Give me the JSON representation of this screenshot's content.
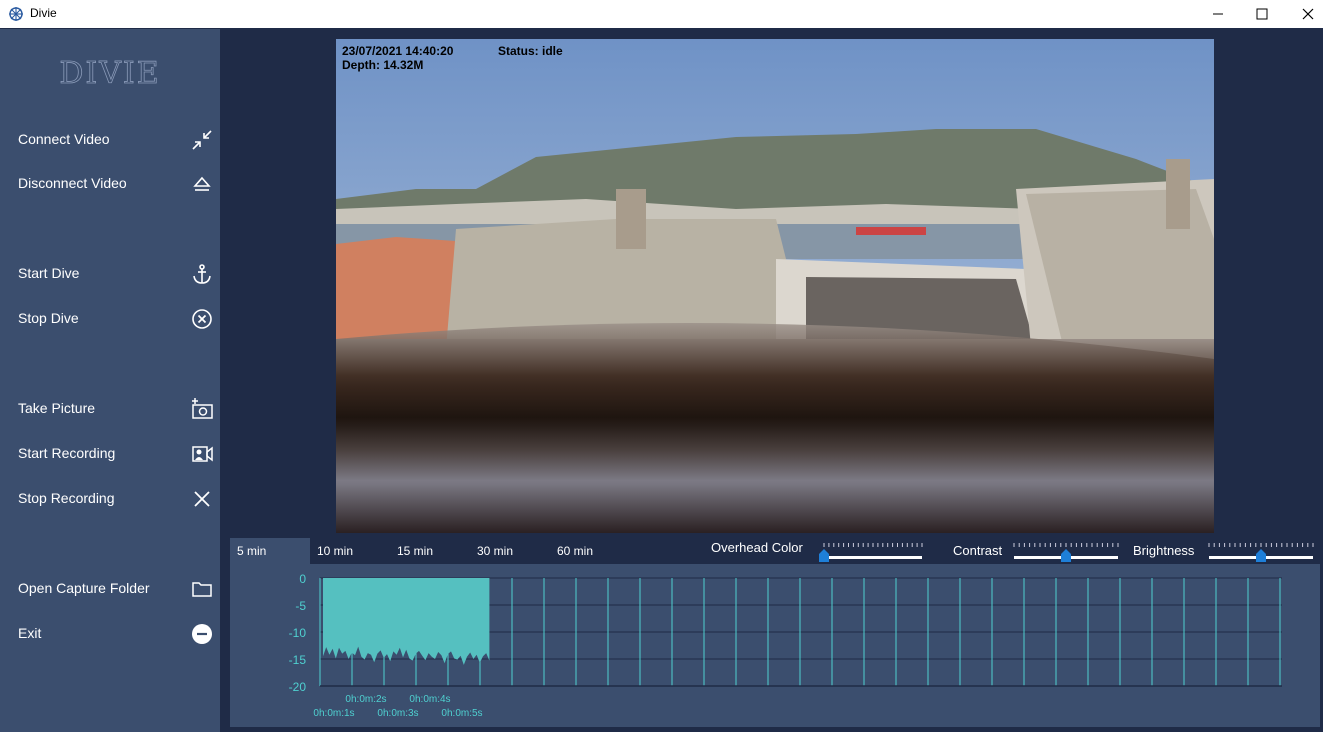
{
  "window": {
    "title": "Divie"
  },
  "logo_text": "DIVIE",
  "sidebar": {
    "items": [
      {
        "label": "Connect Video",
        "icon": "collapse-arrows-icon"
      },
      {
        "label": "Disconnect Video",
        "icon": "eject-icon"
      },
      {
        "label": "Start Dive",
        "icon": "anchor-icon"
      },
      {
        "label": "Stop Dive",
        "icon": "circle-x-icon"
      },
      {
        "label": "Take Picture",
        "icon": "add-camera-icon"
      },
      {
        "label": "Start Recording",
        "icon": "video-camera-icon"
      },
      {
        "label": "Stop Recording",
        "icon": "close-icon"
      },
      {
        "label": "Open Capture Folder",
        "icon": "folder-icon"
      },
      {
        "label": "Exit",
        "icon": "minus-circle-icon"
      }
    ]
  },
  "video": {
    "timestamp": "23/07/2021 14:40:20",
    "status": "Status: idle",
    "depth": "Depth: 14.32M"
  },
  "tabs": [
    {
      "label": "5 min",
      "active": true
    },
    {
      "label": "10 min",
      "active": false
    },
    {
      "label": "15 min",
      "active": false
    },
    {
      "label": "30 min",
      "active": false
    },
    {
      "label": "60 min",
      "active": false
    }
  ],
  "controls": {
    "overhead_color": {
      "label": "Overhead Color",
      "value": 0.0
    },
    "contrast": {
      "label": "Contrast",
      "value": 0.5
    },
    "brightness": {
      "label": "Brightness",
      "value": 0.5
    }
  },
  "colors": {
    "sidebar": "#3b4e6e",
    "background": "#1f2b47",
    "depth_fill": "#55c0c0",
    "axis_text": "#4fd0d0"
  },
  "chart_data": {
    "type": "area",
    "ylim": [
      -20,
      0
    ],
    "y_ticks": [
      "0",
      "-5",
      "-10",
      "-15",
      "-20"
    ],
    "x_tick_labels": [
      "0h:0m:1s",
      "0h:0m:2s",
      "0h:0m:3s",
      "0h:0m:4s",
      "0h:0m:5s"
    ],
    "series": [
      {
        "x": [
          0,
          0.1,
          0.2,
          0.3,
          0.4,
          0.5,
          0.6,
          0.7,
          0.8,
          0.9,
          1.0,
          1.1,
          1.2,
          1.3,
          1.4,
          1.5,
          1.6,
          1.7,
          1.8,
          1.9,
          2.0,
          2.1,
          2.2,
          2.3,
          2.4,
          2.5,
          2.6,
          2.7,
          2.8,
          2.9,
          3.0,
          3.1,
          3.2,
          3.3,
          3.4,
          3.5,
          3.6,
          3.7,
          3.8,
          3.9,
          4.0,
          4.1,
          4.2,
          4.3,
          4.4,
          4.5,
          4.6,
          4.7,
          4.8,
          4.9,
          5.0,
          5.1,
          5.2
        ],
        "values": [
          -14.5,
          -12.8,
          -14.2,
          -13.1,
          -14.9,
          -12.9,
          -14.0,
          -13.5,
          -15.0,
          -13.8,
          -14.3,
          -12.7,
          -14.6,
          -15.1,
          -13.9,
          -14.2,
          -15.6,
          -14.0,
          -13.4,
          -14.8,
          -14.1,
          -15.4,
          -13.6,
          -14.2,
          -12.9,
          -14.7,
          -13.3,
          -14.9,
          -15.3,
          -14.0,
          -13.5,
          -14.4,
          -15.2,
          -13.9,
          -14.6,
          -15.0,
          -13.7,
          -14.3,
          -15.8,
          -14.1,
          -13.6,
          -14.9,
          -15.1,
          -14.4,
          -16.1,
          -14.6,
          -13.8,
          -15.0,
          -14.2,
          -15.7,
          -14.5,
          -13.9,
          -15.3
        ],
        "color": "#55c0c0"
      }
    ]
  }
}
